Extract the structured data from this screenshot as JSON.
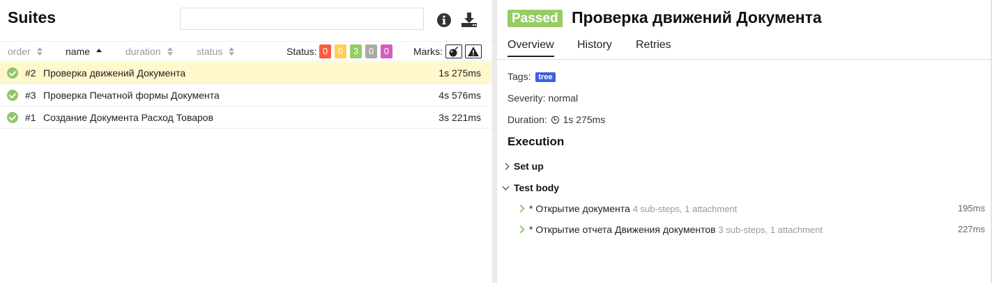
{
  "left": {
    "title": "Suites",
    "search": {
      "value": "",
      "placeholder": ""
    },
    "sort": {
      "order": "order",
      "name": "name",
      "duration": "duration",
      "status": "status"
    },
    "status_label": "Status:",
    "status_counts": [
      {
        "value": "0",
        "color": "#fd5a3e"
      },
      {
        "value": "0",
        "color": "#ffd050"
      },
      {
        "value": "3",
        "color": "#97cc64"
      },
      {
        "value": "0",
        "color": "#aaaaaa"
      },
      {
        "value": "0",
        "color": "#d35ebe"
      }
    ],
    "marks_label": "Marks:",
    "rows": [
      {
        "num": "#2",
        "name": "Проверка движений Документа",
        "duration": "1s 275ms",
        "selected": true
      },
      {
        "num": "#3",
        "name": "Проверка Печатной формы Документа",
        "duration": "4s 576ms",
        "selected": false
      },
      {
        "num": "#1",
        "name": "Создание Документа Расход Товаров",
        "duration": "3s 221ms",
        "selected": false
      }
    ]
  },
  "right": {
    "status_badge": "Passed",
    "title": "Проверка движений Документа",
    "tabs": [
      "Overview",
      "History",
      "Retries"
    ],
    "tags_label": "Tags:",
    "tag": "tree",
    "severity": "Severity: normal",
    "duration_label": "Duration:",
    "duration_value": "1s 275ms",
    "execution_title": "Execution",
    "setup_label": "Set up",
    "testbody_label": "Test body",
    "steps": [
      {
        "name": "* Открытие документа",
        "meta": "4 sub-steps, 1 attachment",
        "duration": "195ms"
      },
      {
        "name": "* Открытие отчета Движения документов",
        "meta": "3 sub-steps, 1 attachment",
        "duration": "227ms"
      }
    ]
  }
}
